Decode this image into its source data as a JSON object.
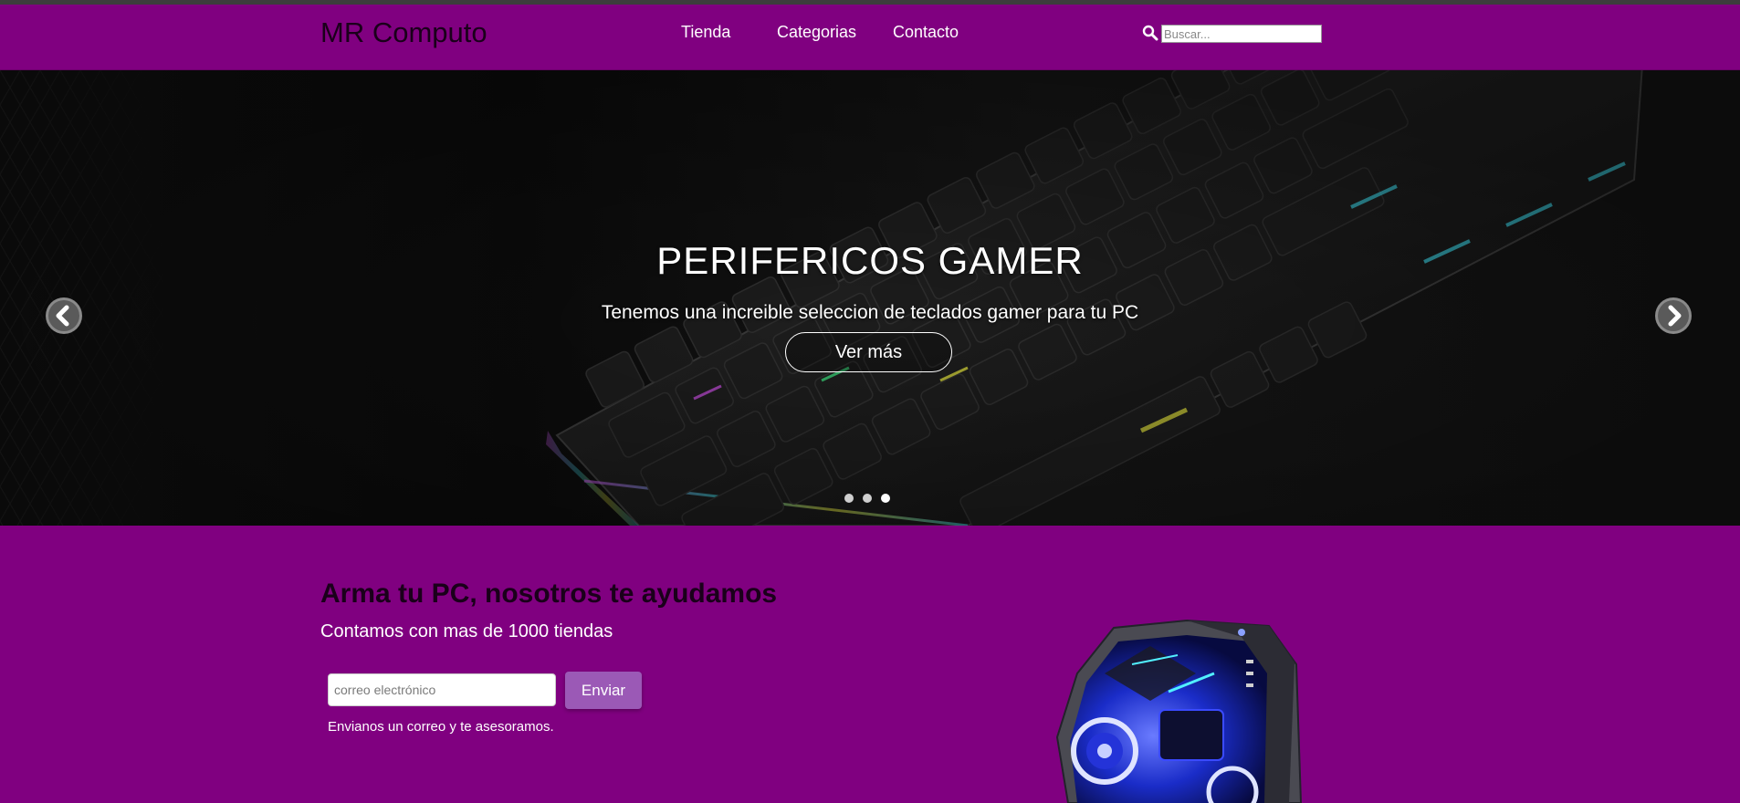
{
  "header": {
    "brand": "MR Computo",
    "nav": [
      {
        "label": "Tienda"
      },
      {
        "label": "Categorias"
      },
      {
        "label": "Contacto"
      }
    ],
    "search": {
      "placeholder": "Buscar...",
      "icon": "search-icon"
    }
  },
  "carousel": {
    "title": "PERIFERICOS GAMER",
    "subtitle": "Tenemos una increible seleccion de teclados gamer para tu PC",
    "button_label": "Ver más",
    "prev_icon": "chevron-left-icon",
    "next_icon": "chevron-right-icon",
    "slide_count": 3,
    "active_slide": 3
  },
  "promo": {
    "title": "Arma tu PC, nosotros te ayudamos",
    "subtitle": "Contamos con mas de 1000 tiendas",
    "email_placeholder": "correo electrónico",
    "send_label": "Enviar",
    "help_text": "Envianos un correo y te asesoramos."
  },
  "colors": {
    "brand_purple": "#800080",
    "button_purple": "#9b59b6"
  }
}
